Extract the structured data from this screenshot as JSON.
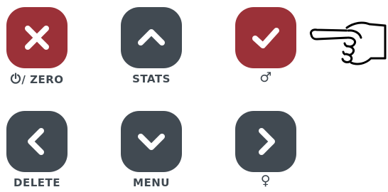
{
  "keys": [
    {
      "id": "zero",
      "label": "/ ZERO",
      "label_icon": "power-icon",
      "icon": "close-icon",
      "color": "#9b3138"
    },
    {
      "id": "stats",
      "label": "STATS",
      "icon": "chevron-up-icon",
      "color": "#414a52"
    },
    {
      "id": "male",
      "label": "♂",
      "icon": "check-icon",
      "color": "#9b3138"
    },
    {
      "id": "delete",
      "label": "DELETE",
      "icon": "chevron-left-icon",
      "color": "#414a52"
    },
    {
      "id": "menu",
      "label": "MENU",
      "icon": "chevron-down-icon",
      "color": "#414a52"
    },
    {
      "id": "female",
      "label": "♀",
      "icon": "chevron-right-icon",
      "color": "#414a52"
    }
  ],
  "pointer": {
    "icon": "pointing-hand-icon"
  },
  "colors": {
    "label": "#3f4850",
    "icon_fg": "#ffffff"
  }
}
